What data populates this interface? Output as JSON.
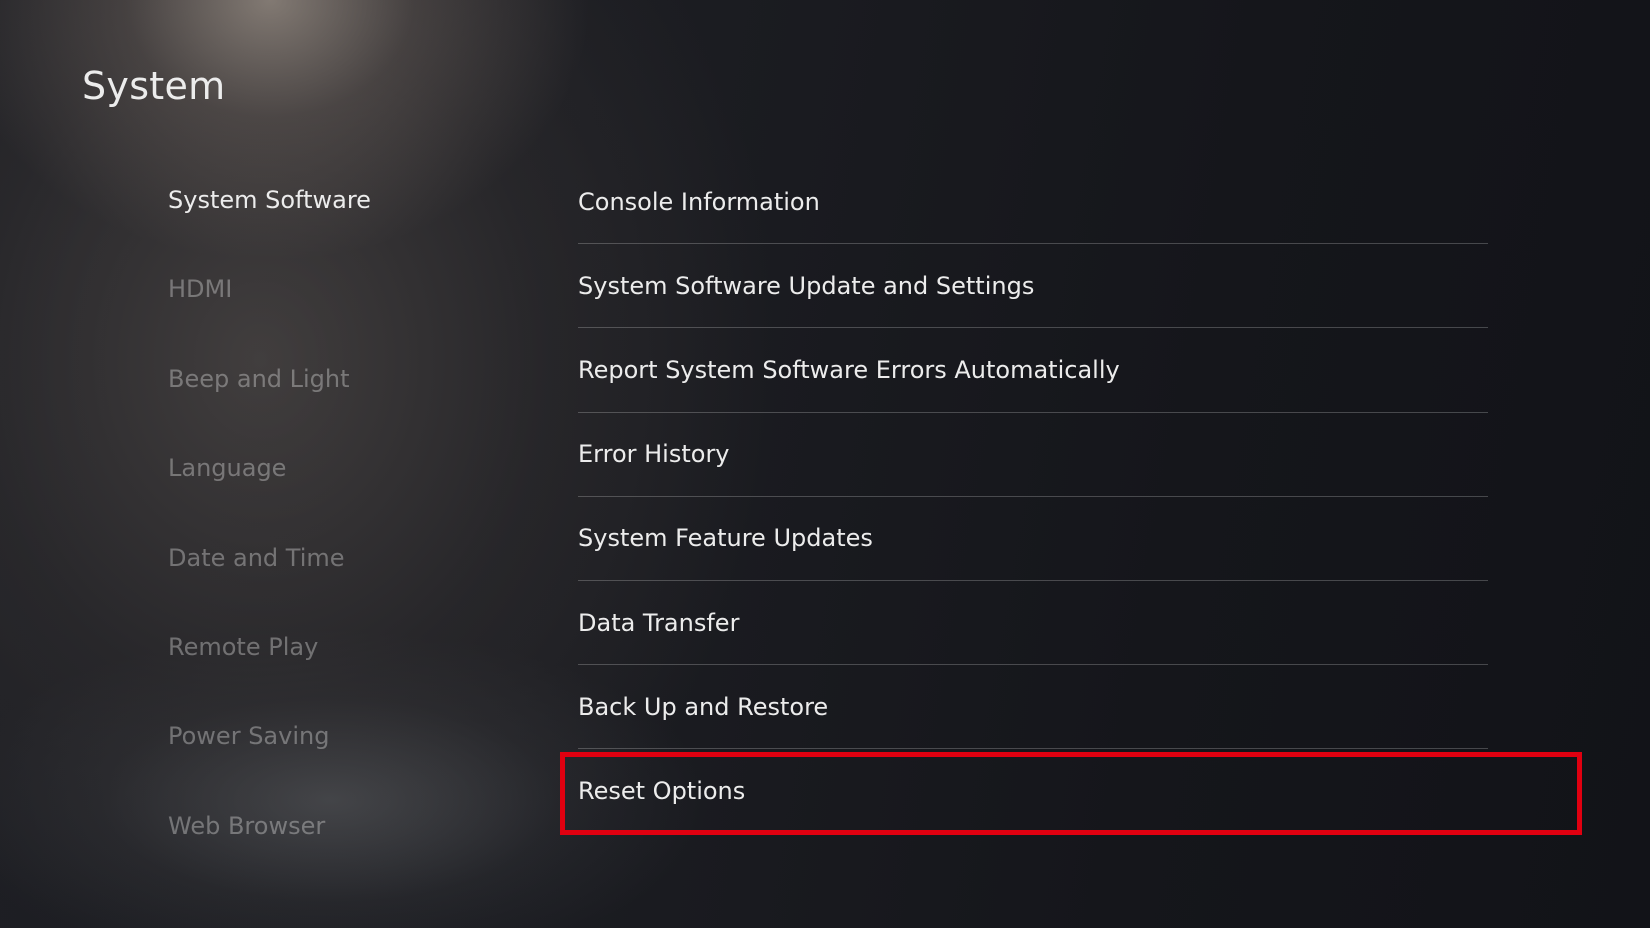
{
  "header": {
    "title": "System"
  },
  "sidebar": {
    "items": [
      {
        "label": "System Software",
        "active": true
      },
      {
        "label": "HDMI",
        "active": false
      },
      {
        "label": "Beep and Light",
        "active": false
      },
      {
        "label": "Language",
        "active": false
      },
      {
        "label": "Date and Time",
        "active": false
      },
      {
        "label": "Remote Play",
        "active": false
      },
      {
        "label": "Power Saving",
        "active": false
      },
      {
        "label": "Web Browser",
        "active": false
      }
    ]
  },
  "main": {
    "items": [
      {
        "label": "Console Information"
      },
      {
        "label": "System Software Update and Settings"
      },
      {
        "label": "Report System Software Errors Automatically"
      },
      {
        "label": "Error History"
      },
      {
        "label": "System Feature Updates"
      },
      {
        "label": "Data Transfer"
      },
      {
        "label": "Back Up and Restore"
      },
      {
        "label": "Reset Options"
      }
    ],
    "highlighted_item": "Reset Options"
  },
  "colors": {
    "highlight": "#e00010",
    "text_active": "#ececec",
    "text_inactive": "#6b6b6b"
  }
}
